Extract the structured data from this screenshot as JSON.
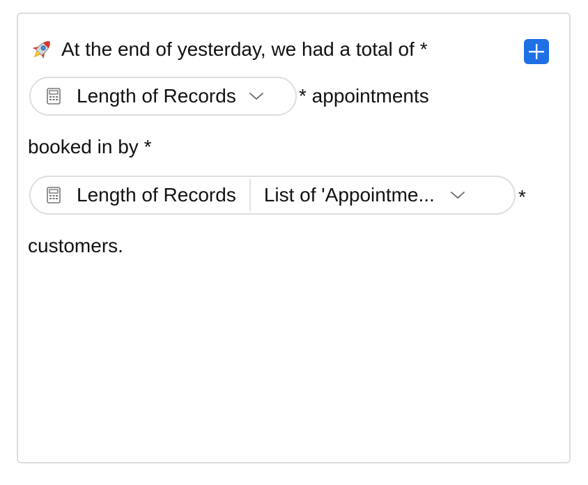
{
  "block": {
    "emoji": "rocket-icon",
    "line1": "At the end of yesterday, we had a total of *",
    "after_pill1": "* appointments",
    "line3": "booked in by *",
    "after_pill2": "*",
    "line5": "customers."
  },
  "add_button": {
    "icon": "plus-icon",
    "color": "#1f6fe5"
  },
  "pill1": {
    "icon": "calculator-icon",
    "label": "Length of Records",
    "chevron": "chevron-down-icon"
  },
  "pill2": {
    "icon": "calculator-icon",
    "label": "Length of Records",
    "secondary": "List of 'Appointme...",
    "chevron": "chevron-down-icon"
  }
}
